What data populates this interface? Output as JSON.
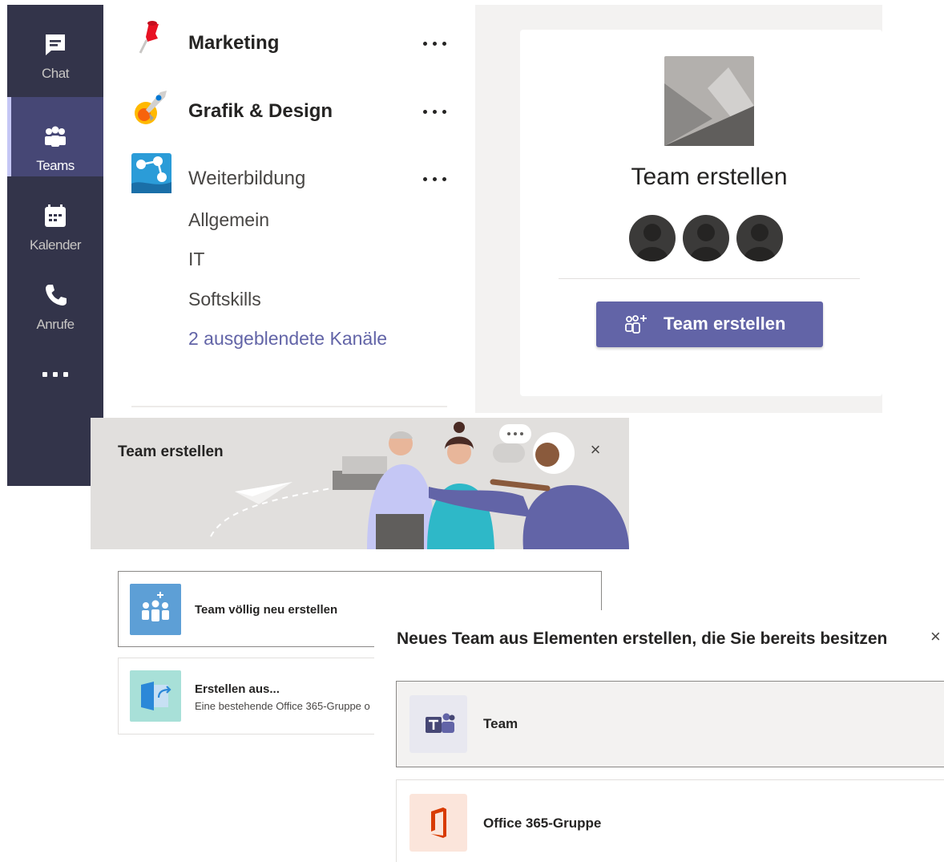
{
  "rail": {
    "items": [
      {
        "label": "Chat",
        "icon": "chat-icon"
      },
      {
        "label": "Teams",
        "icon": "teams-icon",
        "active": true
      },
      {
        "label": "Kalender",
        "icon": "calendar-icon"
      },
      {
        "label": "Anrufe",
        "icon": "phone-icon"
      }
    ],
    "more_icon": "more-icon"
  },
  "teams": [
    {
      "name": "Marketing",
      "icon": "pushpin-icon"
    },
    {
      "name": "Grafik & Design",
      "icon": "rocket-icon"
    },
    {
      "name": "Weiterbildung",
      "icon": "network-icon"
    }
  ],
  "channels": [
    "Allgemein",
    "IT",
    "Softskills"
  ],
  "hidden_channels": "2 ausgeblendete Kanäle",
  "create_card": {
    "title": "Team erstellen",
    "button_label": "Team erstellen",
    "button_icon": "add-people-icon"
  },
  "dialog": {
    "title": "Team erstellen",
    "close_icon": "close-icon",
    "options": [
      {
        "title": "Team völlig neu erstellen",
        "icon": "new-team-icon"
      },
      {
        "title": "Erstellen aus...",
        "subtitle": "Eine bestehende Office 365-Gruppe o",
        "icon": "create-from-icon"
      }
    ]
  },
  "panel": {
    "title": "Neues Team aus Elementen erstellen, die Sie bereits besitzen",
    "close_icon": "close-icon",
    "options": [
      {
        "label": "Team",
        "icon": "teams-logo-icon"
      },
      {
        "label": "Office 365-Gruppe",
        "icon": "office-logo-icon"
      }
    ]
  },
  "colors": {
    "rail": "#33344a",
    "accent": "#6264a7",
    "office": "#d83b01"
  }
}
